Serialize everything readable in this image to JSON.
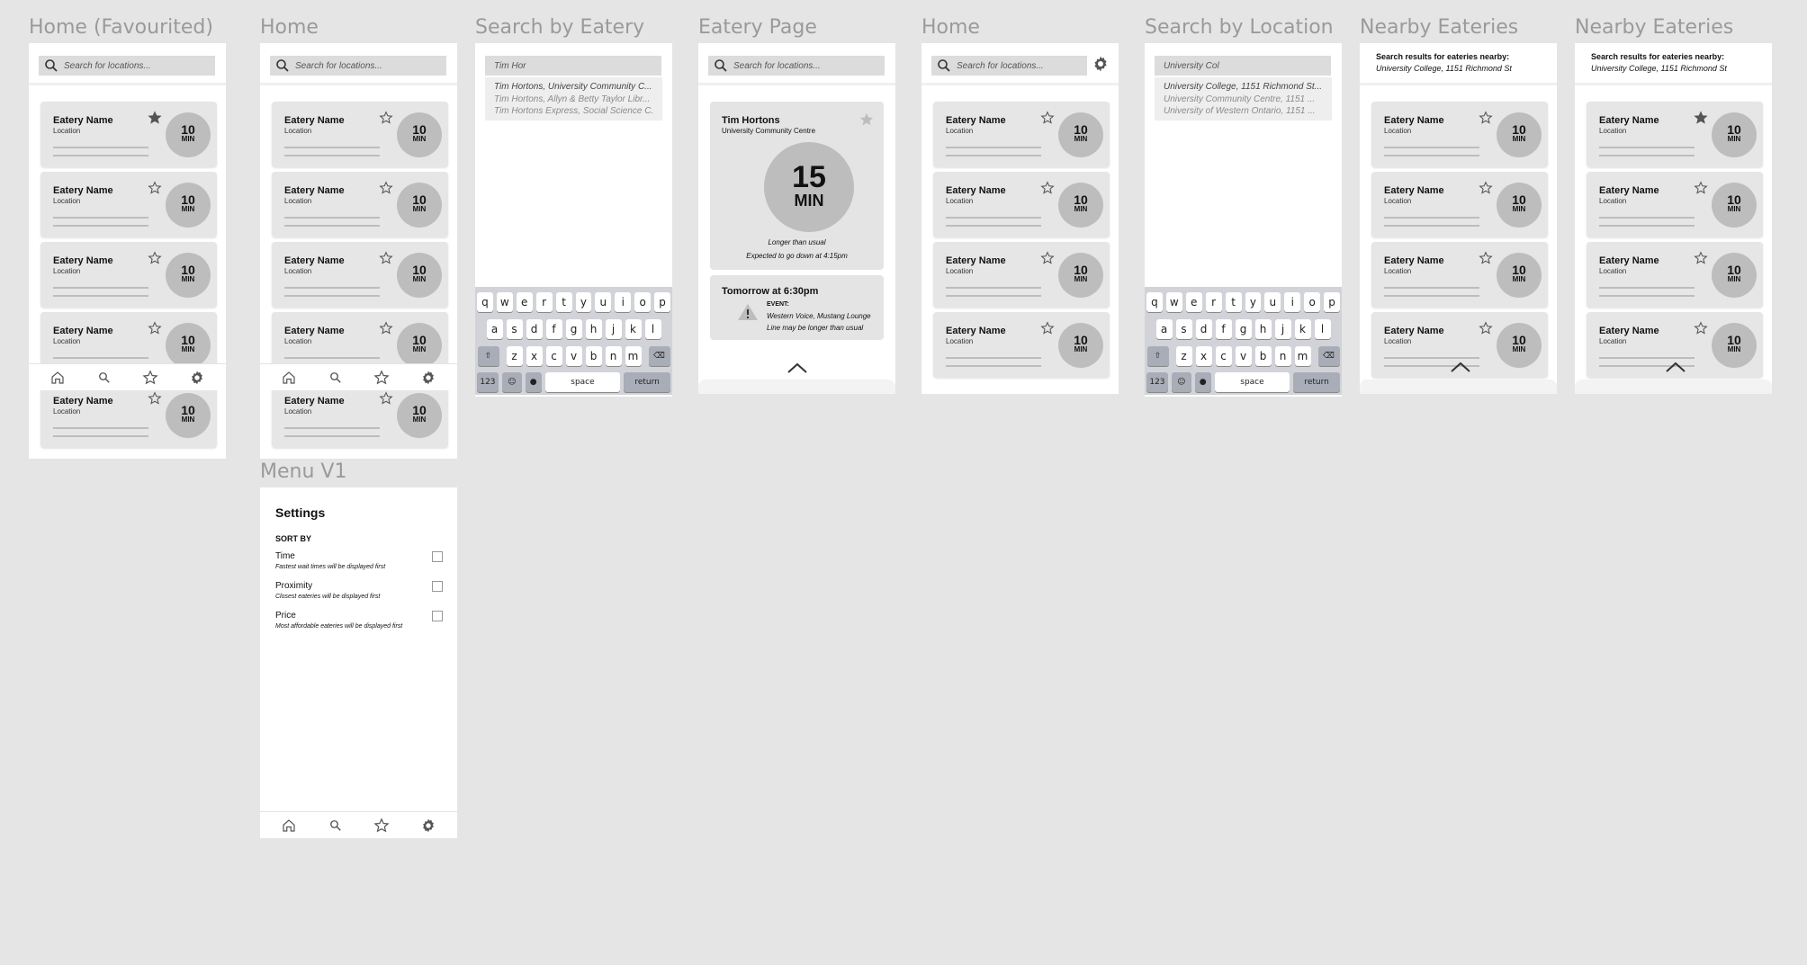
{
  "screens": {
    "s1": {
      "title": "Home (Favourited)",
      "search_placeholder": "Search for locations..."
    },
    "s2": {
      "title": "Home",
      "search_placeholder": "Search for locations..."
    },
    "s3": {
      "title": "Search by Eatery",
      "search_value": "Tim Hor",
      "suggestions": [
        "Tim Hortons, University Community C...",
        "Tim Hortons, Allyn & Betty Taylor Libr...",
        "Tim Hortons Express, Social Science C..."
      ]
    },
    "s4": {
      "title": "Eatery Page",
      "search_placeholder": "Search for locations...",
      "eatery_name": "Tim Hortons",
      "eatery_location": "University Community Centre",
      "wait_value": "15",
      "wait_unit": "MIN",
      "note1": "Longer than usual",
      "note2": "Expected to go down at 4:15pm",
      "event_title": "Tomorrow at 6:30pm",
      "event_label": "EVENT:",
      "event_line1": "Western Voice, Mustang Lounge",
      "event_line2": "Line may be longer than usual"
    },
    "s5": {
      "title": "Home",
      "search_placeholder": "Search for locations..."
    },
    "s6": {
      "title": "Search by Location",
      "search_value": "University Col",
      "suggestions": [
        "University College, 1151 Richmond St...",
        "University Community Centre, 1151 ...",
        "University of Western Ontario, 1151 ..."
      ]
    },
    "s7": {
      "title": "Nearby Eateries",
      "head1": "Search results for eateries nearby:",
      "head2": "University College, 1151 Richmond St"
    },
    "s8": {
      "title": "Nearby Eateries",
      "head1": "Search results for eateries nearby:",
      "head2": "University College, 1151 Richmond St"
    },
    "s9": {
      "title": "Menu V1",
      "settings_title": "Settings",
      "sort_by": "SORT BY",
      "options": [
        {
          "label": "Time",
          "desc": "Fastest wait times will be displayed first"
        },
        {
          "label": "Proximity",
          "desc": "Closest eateries will be displayed first"
        },
        {
          "label": "Price",
          "desc": "Most affordable eateries will be displayed first"
        }
      ]
    }
  },
  "card": {
    "name": "Eatery Name",
    "location": "Location",
    "wait_value": "10",
    "wait_unit": "MIN"
  },
  "keyboard": {
    "row1": [
      "q",
      "w",
      "e",
      "r",
      "t",
      "y",
      "u",
      "i",
      "o",
      "p"
    ],
    "row2": [
      "a",
      "s",
      "d",
      "f",
      "g",
      "h",
      "j",
      "k",
      "l"
    ],
    "row3": [
      "z",
      "x",
      "c",
      "v",
      "b",
      "n",
      "m"
    ],
    "numbers": "123",
    "space": "space",
    "return": "return"
  },
  "favourited_rows": {
    "s1": [
      true,
      false,
      false,
      false,
      false
    ],
    "s8": [
      true,
      false,
      false,
      false
    ]
  },
  "icons": {
    "search": "search-icon",
    "home": "home-icon",
    "star": "star-icon",
    "gear": "gear-icon",
    "warning": "warning-icon",
    "chevron": "chevron-up-icon"
  }
}
